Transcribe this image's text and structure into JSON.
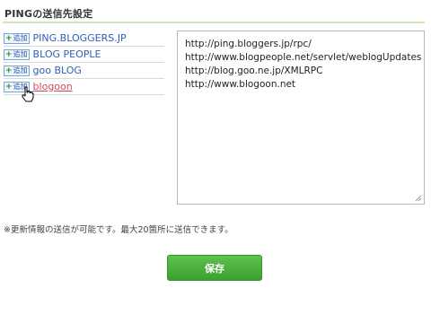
{
  "section": {
    "title": "PINGの送信先設定"
  },
  "add_label": "追加",
  "ping_sites": [
    {
      "label": "PING.BLOGGERS.JP"
    },
    {
      "label": "BLOG PEOPLE"
    },
    {
      "label": "goo BLOG"
    },
    {
      "label": "blogoon"
    }
  ],
  "url_textarea": {
    "value": "http://ping.bloggers.jp/rpc/\nhttp://www.blogpeople.net/servlet/weblogUpdates\nhttp://blog.goo.ne.jp/XMLRPC\nhttp://www.blogoon.net"
  },
  "note": "※更新情報の送信が可能です。最大20箇所に送信できます。",
  "save_button": {
    "label": "保存"
  },
  "colors": {
    "accent": "#47b03a",
    "link": "#2f62b3",
    "link_hover": "#d04a5a"
  }
}
